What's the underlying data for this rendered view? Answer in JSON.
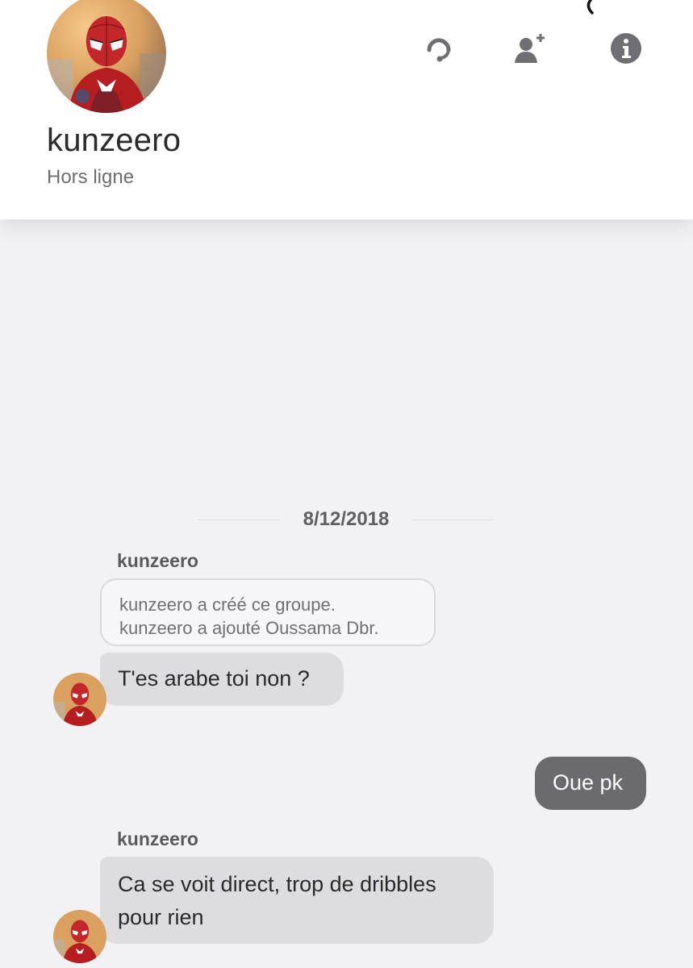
{
  "contact": {
    "name": "kunzeero",
    "status": "Hors ligne",
    "avatar_icon": "spiderman-avatar"
  },
  "header_actions": [
    {
      "name": "voice-chat",
      "icon": "headset-icon"
    },
    {
      "name": "add-participant",
      "icon": "add-user-icon"
    },
    {
      "name": "info",
      "icon": "info-icon"
    }
  ],
  "chat": {
    "date_separator": "8/12/2018",
    "system_group": {
      "sender": "kunzeero",
      "lines": [
        "kunzeero a créé ce groupe.",
        "kunzeero a ajouté Oussama Dbr."
      ]
    },
    "messages": [
      {
        "sender": "kunzeero",
        "direction": "incoming",
        "text": "T'es arabe toi non ?"
      },
      {
        "sender": "",
        "direction": "outgoing",
        "text": "Oue pk"
      },
      {
        "sender": "kunzeero",
        "direction": "incoming",
        "text": "Ca se voit direct, trop de dribbles pour rien"
      }
    ]
  },
  "colors": {
    "background": "#f2f2f4",
    "header_bg": "#ffffff",
    "incoming_bubble": "#dddde0",
    "outgoing_bubble": "#6b6b6d",
    "icon_gray": "#6f6f73"
  }
}
